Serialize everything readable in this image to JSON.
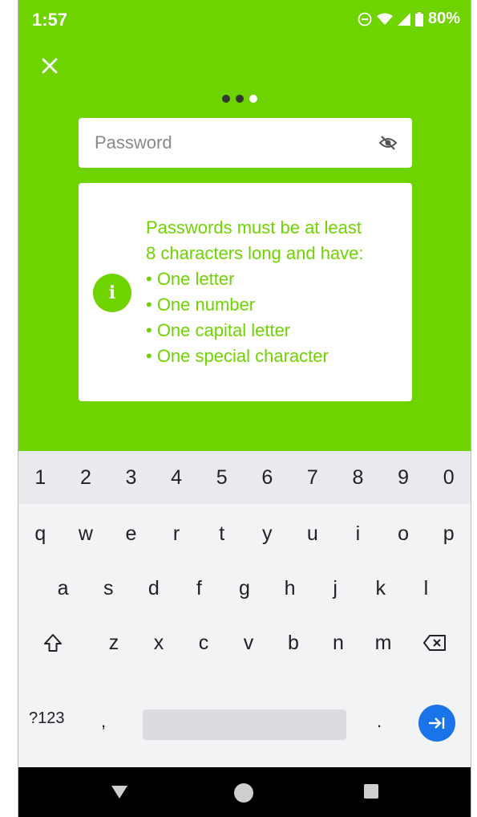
{
  "status_bar": {
    "time": "1:57",
    "battery": "80%",
    "icons": [
      "do-not-disturb-icon",
      "wifi-icon",
      "signal-icon",
      "battery-icon"
    ]
  },
  "header": {
    "close_icon": "close-icon",
    "step_dots": [
      false,
      false,
      true
    ]
  },
  "password_field": {
    "placeholder": "Password",
    "value": "",
    "toggle_icon": "eye-off-icon"
  },
  "info_card": {
    "icon": "info-icon",
    "icon_glyph": "i",
    "lines": [
      "Passwords must be at least",
      "8 characters long and have:",
      "• One letter",
      "• One number",
      "• One capital letter",
      "• One special character"
    ]
  },
  "keyboard": {
    "number_row": [
      "1",
      "2",
      "3",
      "4",
      "5",
      "6",
      "7",
      "8",
      "9",
      "0"
    ],
    "row1": [
      "q",
      "w",
      "e",
      "r",
      "t",
      "y",
      "u",
      "i",
      "o",
      "p"
    ],
    "row2": [
      "a",
      "s",
      "d",
      "f",
      "g",
      "h",
      "j",
      "k",
      "l"
    ],
    "row3": [
      "z",
      "x",
      "c",
      "v",
      "b",
      "n",
      "m"
    ],
    "symbols_label": "?123",
    "comma": ",",
    "period": "."
  },
  "colors": {
    "brand_green": "#6fd300",
    "action_blue": "#1a73e8"
  }
}
